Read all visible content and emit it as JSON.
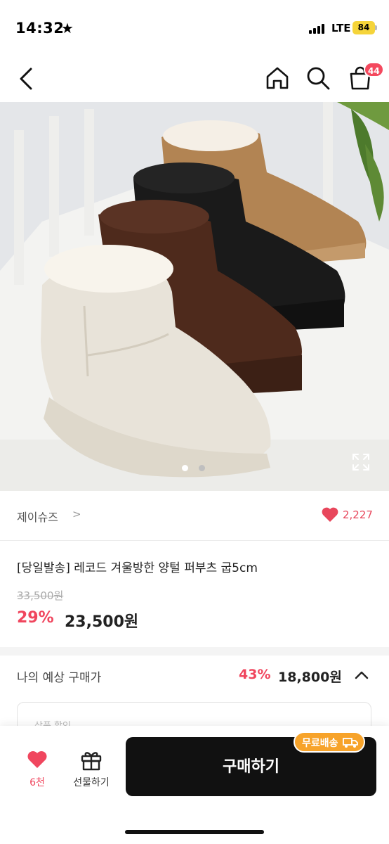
{
  "status_bar": {
    "time": "14:32",
    "network": "LTE",
    "battery": "84"
  },
  "nav": {
    "cart_count": "44"
  },
  "gallery": {
    "current_slide": 1,
    "total_slides": 2
  },
  "seller": {
    "name": "제이슈즈",
    "chevron": ">",
    "likes": "2,227"
  },
  "product": {
    "title": "[당일발송] 레코드 겨울방한 양털 퍼부츠 굽5cm",
    "original_price": "33,500원",
    "discount": "29%",
    "price": "23,500원"
  },
  "expected": {
    "label": "나의 예상 구매가",
    "discount": "43%",
    "price": "18,800원",
    "coupon_partial": "상품 할인"
  },
  "bottom": {
    "wish_count": "6천",
    "gift_label": "선물하기",
    "buy_label": "구매하기",
    "shipping_badge": "무료배송"
  },
  "colors": {
    "accent": "#f0465e",
    "badge": "#f7a32a",
    "buy_button": "#111111"
  }
}
